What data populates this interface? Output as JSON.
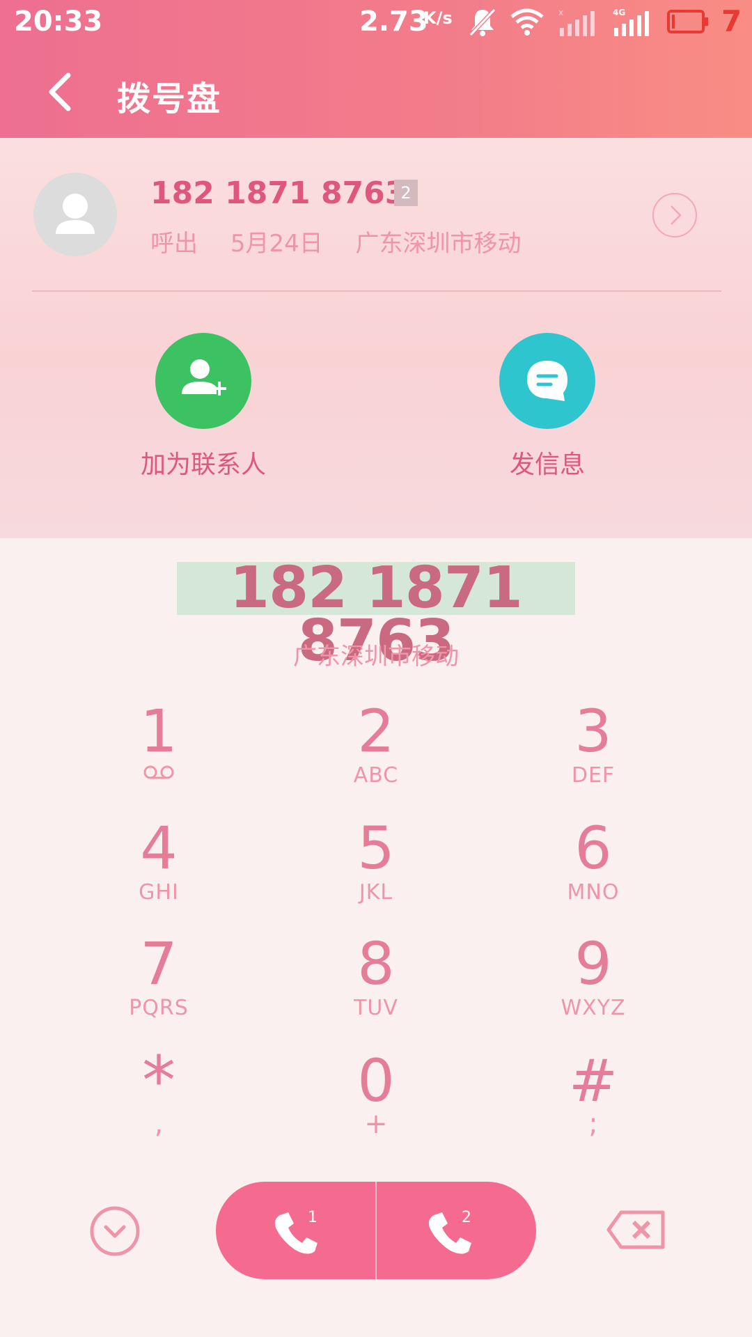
{
  "status_bar": {
    "time": "20:33",
    "net_speed": "2.73",
    "net_unit": "K/s",
    "battery_level": "7",
    "icons": [
      "mute-icon",
      "wifi-icon",
      "signal-sim1-icon",
      "signal-4g-icon",
      "battery-low-icon"
    ],
    "network_type": "4G",
    "colors": {
      "battery_low": "#e83a32"
    }
  },
  "app_bar": {
    "title": "拨号盘"
  },
  "recent_call": {
    "number": "182 1871 8763",
    "sim_badge": "2",
    "call_type": "呼出",
    "date": "5月24日",
    "location": "广东深圳市移动"
  },
  "actions": {
    "add_contact": "加为联系人",
    "send_message": "发信息",
    "colors": {
      "add_contact": "#3cc163",
      "send_message": "#2ec5cf"
    }
  },
  "dialer": {
    "number": "182 1871 8763",
    "location": "广东深圳市移动",
    "keys": [
      {
        "digit": "1",
        "sub": "voicemail-icon"
      },
      {
        "digit": "2",
        "sub": "ABC"
      },
      {
        "digit": "3",
        "sub": "DEF"
      },
      {
        "digit": "4",
        "sub": "GHI"
      },
      {
        "digit": "5",
        "sub": "JKL"
      },
      {
        "digit": "6",
        "sub": "MNO"
      },
      {
        "digit": "7",
        "sub": "PQRS"
      },
      {
        "digit": "8",
        "sub": "TUV"
      },
      {
        "digit": "9",
        "sub": "WXYZ"
      },
      {
        "digit": "*",
        "sub": ","
      },
      {
        "digit": "0",
        "sub": "+"
      },
      {
        "digit": "#",
        "sub": ";"
      }
    ]
  },
  "controls": {
    "call_sim1_label": "1",
    "call_sim2_label": "2",
    "colors": {
      "accent": "#f56a8f",
      "text": "#e0577e"
    }
  }
}
